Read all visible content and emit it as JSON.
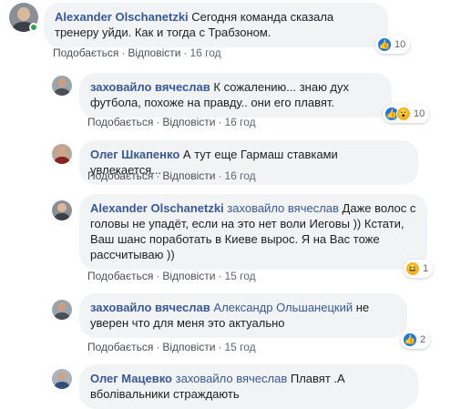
{
  "comments": [
    {
      "author": "Alexander Olschanetzki",
      "reply_to": "",
      "text": "Сегодня команда сказала тренеру уйди. Как и тогда с Трабзоном.",
      "like_label": "Подобається",
      "reply_label": "Відповісти",
      "time": "16 год",
      "reaction_count": "10",
      "reaction_icons": [
        "like-icon"
      ]
    },
    {
      "author": "заховайло вячеслав",
      "reply_to": "",
      "text": "К сожалению... знаю дух футбола, похоже на правду.. они его плавят.",
      "like_label": "Подобається",
      "reply_label": "Відповісти",
      "time": "16 год",
      "reaction_count": "10",
      "reaction_icons": [
        "like-icon",
        "wow-icon"
      ]
    },
    {
      "author": "Олег Шкапенко",
      "reply_to": "",
      "text": "А тут еще Гармаш ставками увлекается...",
      "like_label": "Подобається",
      "reply_label": "Відповісти",
      "time": "16 год",
      "reaction_count": "",
      "reaction_icons": []
    },
    {
      "author": "Alexander Olschanetzki",
      "reply_to": "заховайло вячеслав",
      "text": "Даже волос с головы не упадёт, если на это нет воли Иеговы )) Кстати, Ваш шанс поработать в Киеве вырос. Я на Вас тоже рассчитываю ))",
      "like_label": "Подобається",
      "reply_label": "Відповісти",
      "time": "15 год",
      "reaction_count": "1",
      "reaction_icons": [
        "haha-icon"
      ]
    },
    {
      "author": "заховайло вячеслав",
      "reply_to": "Александр Ольшанецкий",
      "text": "не уверен что для меня это актуально",
      "like_label": "Подобається",
      "reply_label": "Відповісти",
      "time": "15 год",
      "reaction_count": "2",
      "reaction_icons": [
        "like-icon"
      ]
    },
    {
      "author": "Олег Мацевко",
      "reply_to": "заховайло вячеслав",
      "text": "Плавят .А вболівальники страждають",
      "like_label": "",
      "reply_label": "",
      "time": "",
      "reaction_count": "",
      "reaction_icons": []
    }
  ],
  "colors": {
    "name": "#385898",
    "bubble": "#f2f3f5",
    "like": "#1877f2",
    "online": "#31a24c"
  }
}
